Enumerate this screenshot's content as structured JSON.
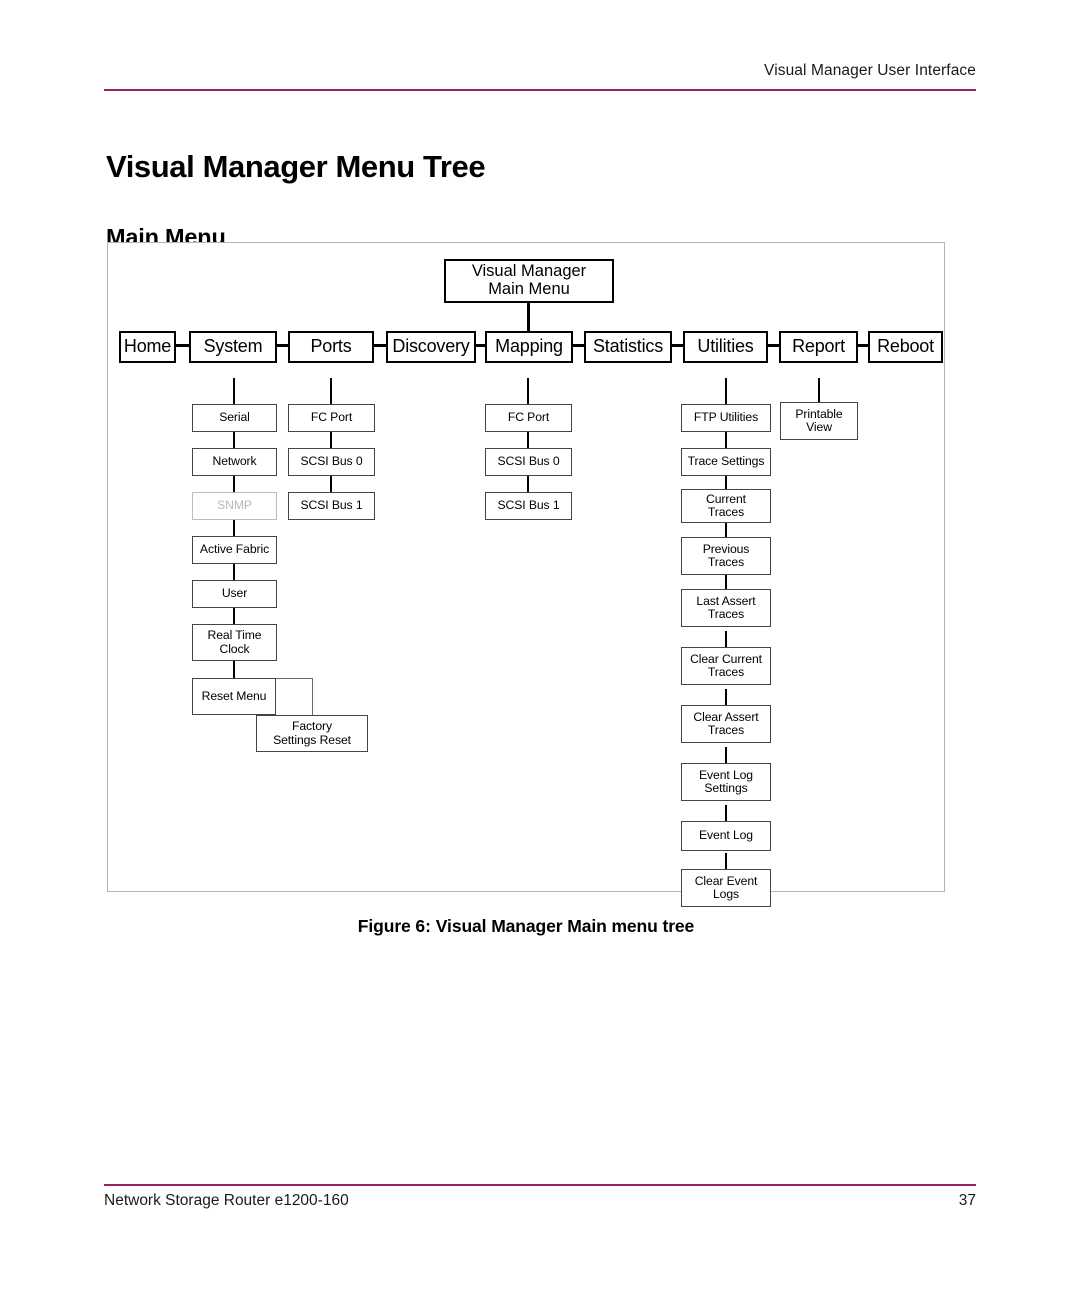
{
  "header": {
    "running_head": "Visual Manager User Interface",
    "rule_color": "#9e1f63"
  },
  "page_title": "Visual Manager Menu Tree",
  "section_title": "Main Menu",
  "figure": {
    "caption_number": "Figure 6:",
    "caption_text": "Visual Manager Main menu tree",
    "border_color": "#b3b3b3"
  },
  "footer": {
    "document": "Network Storage Router e1200-160",
    "page_number": "37",
    "rule_color": "#9e1f63"
  },
  "chart_data": {
    "type": "diagram",
    "diagram_kind": "menu-tree",
    "title": "Visual Manager Main menu tree",
    "root": {
      "label_line1": "Visual Manager",
      "label_line2": "Main Menu"
    },
    "columns": [
      {
        "id": "home",
        "label": "Home",
        "children": []
      },
      {
        "id": "system",
        "label": "System",
        "children": [
          {
            "label": "Serial",
            "state": "enabled"
          },
          {
            "label": "Network",
            "state": "enabled"
          },
          {
            "label": "SNMP",
            "state": "disabled"
          },
          {
            "label": "Active Fabric",
            "state": "enabled"
          },
          {
            "label": "User",
            "state": "enabled"
          },
          {
            "label_line1": "Real Time",
            "label_line2": "Clock",
            "state": "enabled"
          },
          {
            "label": "Reset Menu",
            "state": "enabled",
            "children": [
              {
                "label_line1": "Factory",
                "label_line2": "Settings Reset",
                "state": "enabled"
              }
            ]
          }
        ]
      },
      {
        "id": "ports",
        "label": "Ports",
        "children": [
          {
            "label": "FC Port",
            "state": "enabled"
          },
          {
            "label": "SCSI Bus 0",
            "state": "enabled"
          },
          {
            "label": "SCSI Bus 1",
            "state": "enabled"
          }
        ]
      },
      {
        "id": "discovery",
        "label": "Discovery",
        "children": []
      },
      {
        "id": "mapping",
        "label": "Mapping",
        "children": [
          {
            "label": "FC Port",
            "state": "enabled"
          },
          {
            "label": "SCSI Bus 0",
            "state": "enabled"
          },
          {
            "label": "SCSI Bus 1",
            "state": "enabled"
          }
        ]
      },
      {
        "id": "statistics",
        "label": "Statistics",
        "children": []
      },
      {
        "id": "utilities",
        "label": "Utilities",
        "children": [
          {
            "label": "FTP Utilities",
            "state": "enabled"
          },
          {
            "label": "Trace Settings",
            "state": "enabled"
          },
          {
            "label_line1": "Current",
            "label_line2": "Traces",
            "state": "enabled"
          },
          {
            "label_line1": "Previous",
            "label_line2": "Traces",
            "state": "enabled"
          },
          {
            "label_line1": "Last Assert",
            "label_line2": "Traces",
            "state": "enabled"
          },
          {
            "label_line1": "Clear Current",
            "label_line2": "Traces",
            "state": "enabled"
          },
          {
            "label_line1": "Clear Assert",
            "label_line2": "Traces",
            "state": "enabled"
          },
          {
            "label_line1": "Event Log",
            "label_line2": "Settings",
            "state": "enabled"
          },
          {
            "label": "Event Log",
            "state": "enabled"
          },
          {
            "label_line1": "Clear Event",
            "label_line2": "Logs",
            "state": "enabled"
          }
        ]
      },
      {
        "id": "report",
        "label": "Report",
        "children": [
          {
            "label_line1": "Printable",
            "label_line2": "View",
            "state": "enabled"
          }
        ]
      },
      {
        "id": "reboot",
        "label": "Reboot",
        "children": []
      }
    ]
  },
  "nodes": {
    "root_l1": "Visual Manager",
    "root_l2": "Main Menu",
    "home": "Home",
    "system": "System",
    "ports": "Ports",
    "discovery": "Discovery",
    "mapping": "Mapping",
    "statistics": "Statistics",
    "utilities": "Utilities",
    "report": "Report",
    "reboot": "Reboot",
    "sys_serial": "Serial",
    "sys_network": "Network",
    "sys_snmp": "SNMP",
    "sys_active_fabric": "Active Fabric",
    "sys_user": "User",
    "sys_rtc_l1": "Real Time",
    "sys_rtc_l2": "Clock",
    "sys_reset_menu": "Reset Menu",
    "sys_factory_l1": "Factory",
    "sys_factory_l2": "Settings Reset",
    "ports_fc": "FC Port",
    "ports_scsi0": "SCSI Bus 0",
    "ports_scsi1": "SCSI Bus 1",
    "map_fc": "FC Port",
    "map_scsi0": "SCSI Bus 0",
    "map_scsi1": "SCSI Bus 1",
    "util_ftp": "FTP Utilities",
    "util_trace_settings": "Trace Settings",
    "util_current_l1": "Current",
    "util_current_l2": "Traces",
    "util_previous_l1": "Previous",
    "util_previous_l2": "Traces",
    "util_lastassert_l1": "Last Assert",
    "util_lastassert_l2": "Traces",
    "util_clearcurrent_l1": "Clear Current",
    "util_clearcurrent_l2": "Traces",
    "util_clearassert_l1": "Clear Assert",
    "util_clearassert_l2": "Traces",
    "util_eventlogset_l1": "Event Log",
    "util_eventlogset_l2": "Settings",
    "util_eventlog": "Event Log",
    "util_clearevent_l1": "Clear Event",
    "util_clearevent_l2": "Logs",
    "report_printable_l1": "Printable",
    "report_printable_l2": "View"
  }
}
